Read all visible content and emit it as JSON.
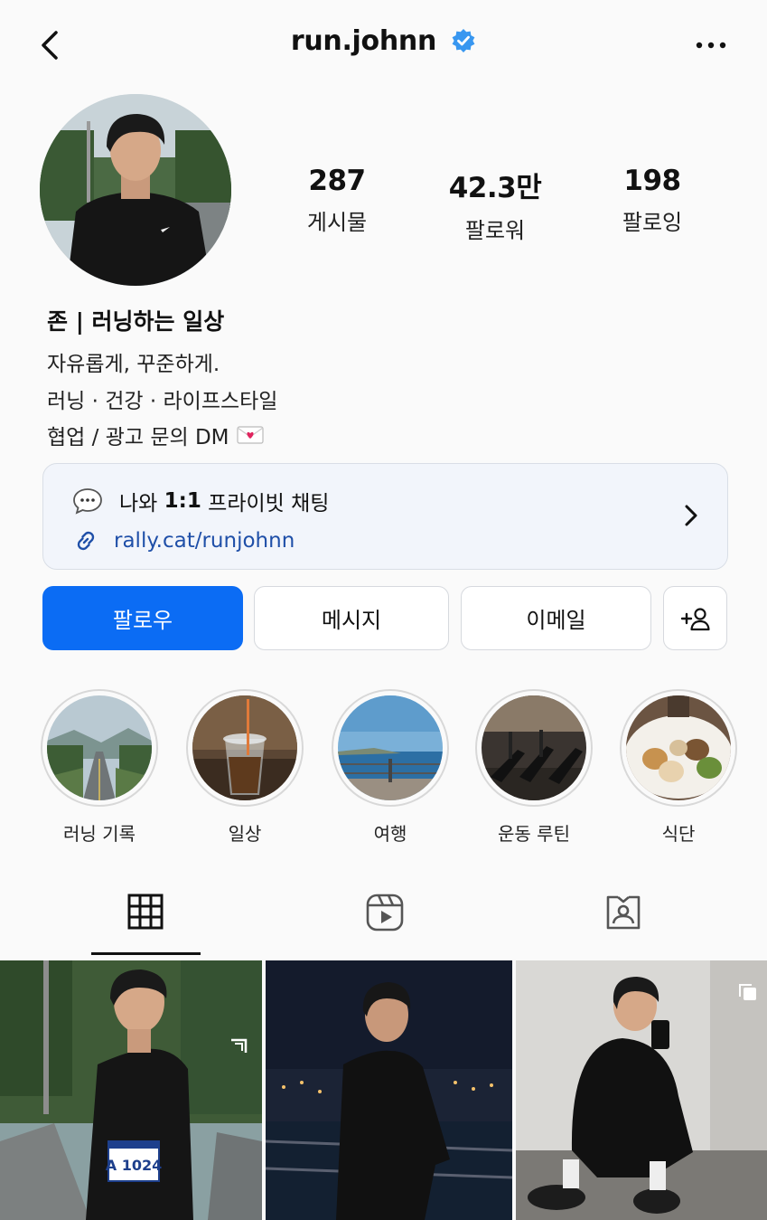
{
  "header": {
    "username": "run.johnn",
    "verified_color": "#3897f0",
    "back_icon": "chevron-left-icon",
    "more_icon": "more-dots-icon"
  },
  "stats": [
    {
      "value": "287",
      "label": "게시물"
    },
    {
      "value": "42.3만",
      "label": "팔로워"
    },
    {
      "value": "198",
      "label": "팔로잉"
    }
  ],
  "bio": {
    "name": "존 | 러닝하는 일상",
    "lines": [
      "자유롭게, 꾸준하게.",
      "러닝 · 건강 · 라이프스타일",
      "협업 / 광고 문의 DM"
    ],
    "line3_emoji_icon": "love-letter-icon"
  },
  "link_card": {
    "chat_prefix": "나와 ",
    "chat_bold": "1:1",
    "chat_suffix": " 프라이빗 채팅",
    "url": "rally.cat/runjohnn"
  },
  "buttons": {
    "follow": "팔로우",
    "message": "메시지",
    "email": "이메일",
    "add_user_icon": "add-user-icon"
  },
  "highlights": [
    {
      "label": "러닝 기록"
    },
    {
      "label": "일상"
    },
    {
      "label": "여행"
    },
    {
      "label": "운동 루틴"
    },
    {
      "label": "식단"
    }
  ],
  "tabs": [
    {
      "icon": "grid-icon",
      "active": true
    },
    {
      "icon": "reels-icon",
      "active": false
    },
    {
      "icon": "tagged-icon",
      "active": false
    }
  ],
  "posts": [
    {
      "bib": "A 1024",
      "badge": "reel-icon"
    },
    {
      "badge": ""
    },
    {
      "badge": "carousel-icon"
    }
  ],
  "colors": {
    "accent": "#0b6cf4",
    "link": "#1f4fa8",
    "background": "#fafafa"
  }
}
